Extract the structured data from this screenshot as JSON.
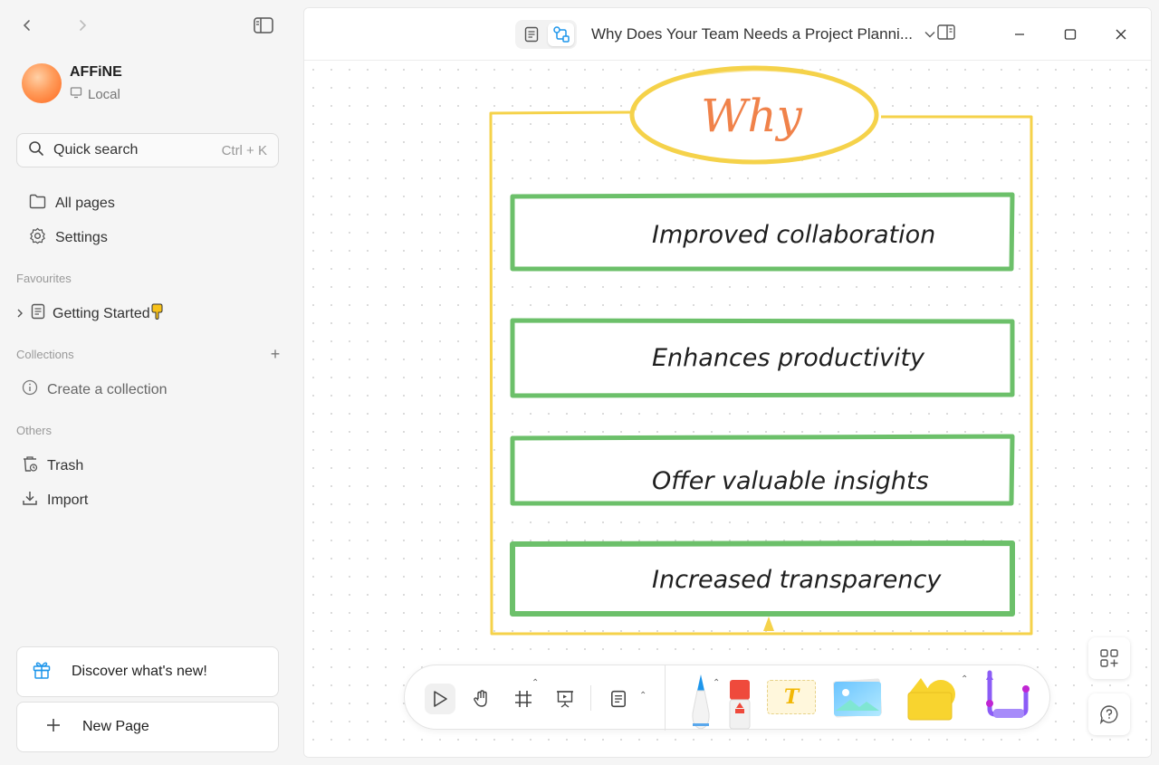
{
  "workspace": {
    "name": "AFFiNE",
    "storage": "Local"
  },
  "search": {
    "label": "Quick search",
    "shortcut": "Ctrl + K"
  },
  "nav": {
    "all_pages": "All pages",
    "settings": "Settings"
  },
  "favourites": {
    "label": "Favourites",
    "items": [
      {
        "label": "Getting Started"
      }
    ]
  },
  "collections": {
    "label": "Collections",
    "create": "Create a collection"
  },
  "others": {
    "label": "Others",
    "trash": "Trash",
    "import": "Import"
  },
  "bottom": {
    "discover": "Discover what's new!",
    "new_page": "New Page"
  },
  "document": {
    "title": "Why Does Your Team Needs a Project Planni..."
  },
  "board": {
    "heading": "Why",
    "items": [
      "Improved collaboration",
      "Enhances productivity",
      "Offer valuable insights",
      "Increased transparency"
    ]
  },
  "colors": {
    "frame": "#f5d24a",
    "heading_text": "#f0824a",
    "item_border": "#6cc06a",
    "accent_blue": "#1e96eb"
  },
  "icons": {
    "sticker_text": "T"
  }
}
